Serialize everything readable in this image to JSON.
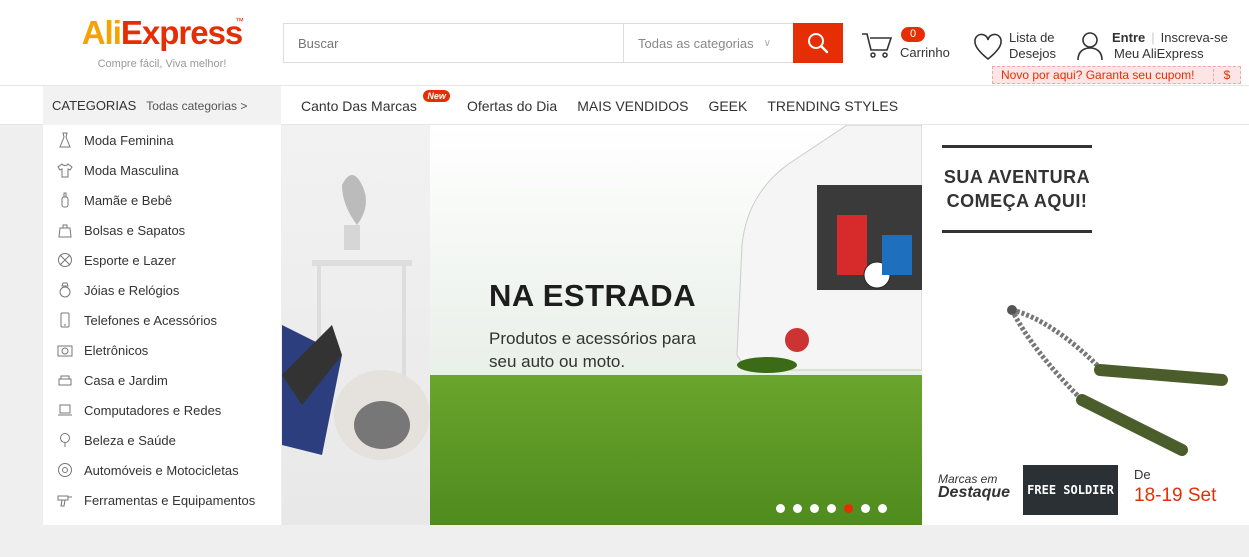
{
  "logo": {
    "brand_part1": "Ali",
    "brand_part2": "Express",
    "tm": "™",
    "tagline": "Compre fácil, Viva melhor!"
  },
  "search": {
    "placeholder": "Buscar",
    "category": "Todas as categorias"
  },
  "cart": {
    "count": "0",
    "label": "Carrinho"
  },
  "wishlist": {
    "line1": "Lista de",
    "line2": "Desejos"
  },
  "account": {
    "signin": "Entre",
    "register": "Inscreva-se",
    "my_account": "Meu AliExpress"
  },
  "coupon": {
    "text": "Novo por aqui? Garanta seu cupom!",
    "currency": "$"
  },
  "navbar": {
    "categories_title": "CATEGORIAS",
    "all_categories": "Todas categorias >",
    "links": [
      "Canto Das Marcas",
      "Ofertas do Dia",
      "MAIS VENDIDOS",
      "GEEK",
      "TRENDING STYLES"
    ],
    "new_badge": "New"
  },
  "categories": [
    "Moda Feminina",
    "Moda Masculina",
    "Mamãe e Bebê",
    "Bolsas e Sapatos",
    "Esporte e Lazer",
    "Jóias e Relógios",
    "Telefones e Acessórios",
    "Eletrônicos",
    "Casa e Jardim",
    "Computadores e Redes",
    "Beleza e Saúde",
    "Automóveis e Motocicletas",
    "Ferramentas e Equipamentos"
  ],
  "banner": {
    "headline": "NA ESTRADA",
    "subtitle": "Produtos e acessórios para seu auto ou moto.",
    "slide_count": 7,
    "active_slide": 5
  },
  "promo": {
    "title": "SUA AVENTURA COMEÇA AQUI!",
    "marcas_line1": "Marcas em",
    "marcas_line2": "Destaque",
    "brand": "FREE SOLDIER",
    "de": "De",
    "dates": "18-19 Set"
  },
  "colors": {
    "accent": "#e62e04",
    "logo_orange": "#f4a300"
  }
}
